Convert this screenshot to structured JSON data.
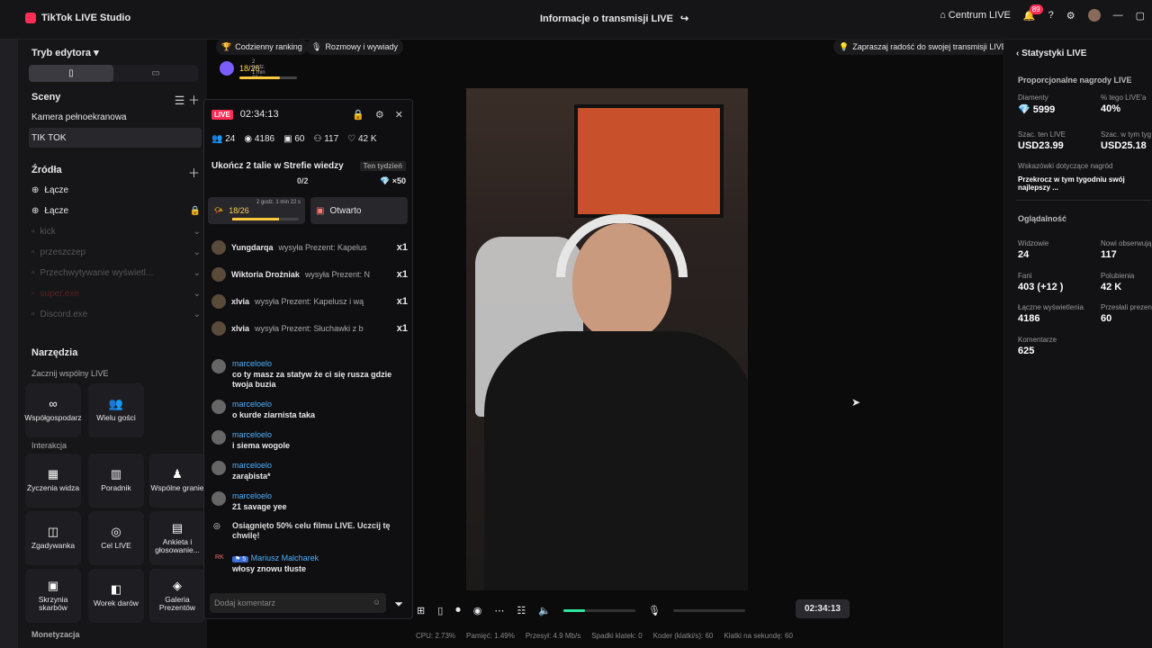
{
  "titlebar": {
    "app": "TikTok LIVE Studio",
    "center": "Informacje o transmisji LIVE",
    "centrum": "Centrum LIVE",
    "notifications": "89"
  },
  "left": {
    "editor": "Tryb edytora",
    "scenes_title": "Sceny",
    "scenes": [
      "Kamera pełnoekranowa",
      "TIK TOK"
    ],
    "sources_title": "Źródła",
    "sources": [
      "Łącze",
      "Łącze",
      "kick",
      "przeszczep",
      "Przechwytywanie wyświetl...",
      "super.exe",
      "Discord.exe"
    ]
  },
  "tools": {
    "title": "Narzędzia",
    "coop": "Zacznij wspólny LIVE",
    "coop_items": [
      "Współgospodarz",
      "Wielu gości"
    ],
    "interact": "Interakcja",
    "items": [
      "Życzenia widza",
      "Poradnik",
      "Wspólne granie",
      "Zgadywanka",
      "Cel LIVE",
      "Ankieta i głosowanie...",
      "Skrzynia skarbów",
      "Worek darów",
      "Galeria Prezentów"
    ],
    "money": "Monetyzacja"
  },
  "chips": {
    "ranking": "Codzienny ranking",
    "talks": "Rozmowy i wywiady",
    "invite": "Zapraszaj radość do swojej transmisji LIVE",
    "progress": "18/26",
    "timer": "2 godz. 1 min 22 s"
  },
  "chat": {
    "live": "LIVE",
    "time": "02:34:13",
    "stats": [
      "24",
      "4186",
      "60",
      "117",
      "42 K"
    ],
    "goal_title": "Ukończ 2 talie w Strefie wiedzy",
    "goal_tag": "Ten tydzień",
    "goal_prog": "0/2",
    "goal_reward": "×50",
    "bar_progress": "18/26",
    "bar_timer": "2 godz. 1 min 22 s",
    "open": "Otwarto",
    "gifts": [
      {
        "user": "Yungdarqa",
        "text": "wysyła Prezent: Kapelus",
        "count": "x1"
      },
      {
        "user": "Wiktoria Drożniak",
        "text": "wysyła Prezent: N",
        "count": "x1"
      },
      {
        "user": "xlvia",
        "text": "wysyła Prezent: Kapelusz i wą",
        "count": "x1"
      },
      {
        "user": "xlvia",
        "text": "wysyła Prezent: Słuchawki z b",
        "count": "x1"
      }
    ],
    "messages": [
      {
        "user": "marceloelo",
        "text": "co ty masz za statyw że ci się rusza gdzie twoja buzia"
      },
      {
        "user": "marceloelo",
        "text": "o kurde ziarnista taka"
      },
      {
        "user": "marceloelo",
        "text": "i siema wogole"
      },
      {
        "user": "marceloelo",
        "text": "zarąbista*"
      },
      {
        "user": "marceloelo",
        "text": "21 savage yee"
      }
    ],
    "system": "Osiągnięto 50% celu filmu LIVE. Uczcij tę chwilę!",
    "badge_user": "Mariusz Malcharek",
    "badge_level": "5",
    "badge_text": "włosy znowu tłuste",
    "comment_placeholder": "Dodaj komentarz"
  },
  "player": {
    "time": "02:34:13",
    "volume_level": 0.3
  },
  "status": {
    "cpu": "CPU: 2.73%",
    "mem": "Pamięć: 1.49%",
    "bitrate": "Przesył: 4.9 Mb/s",
    "dropped": "Spadki klatek: 0",
    "encoder": "Koder (klatki/s): 60",
    "fps": "Klatki na sekundę: 60"
  },
  "stats": {
    "title": "Statystyki LIVE",
    "gifts_h": "Proporcjonalne nagrody LIVE",
    "diamonds_l": "Diamenty",
    "diamonds": "5999",
    "pct_l": "% tego LIVE'a",
    "pct": "40%",
    "est_l": "Szac. ten LIVE",
    "est": "USD23.99",
    "est_w_l": "Szac. w tym tyg",
    "est_w": "USD25.18",
    "tips_l": "Wskazówki dotyczące nagród",
    "tips": "Przekrocz w tym tygodniu swój najlepszy ...",
    "views_h": "Oglądalność",
    "viewers_l": "Widzowie",
    "viewers": "24",
    "newf_l": "Nowi obserwują",
    "newf": "117",
    "fans_l": "Fani",
    "fans": "403 (+12 )",
    "likes_l": "Polubienia",
    "likes": "42 K",
    "totalv_l": "Łączne wyświetlenia",
    "totalv": "4186",
    "sent_l": "Przesłali prezen",
    "sent": "60",
    "comm_l": "Komentarze",
    "comm": "625"
  }
}
